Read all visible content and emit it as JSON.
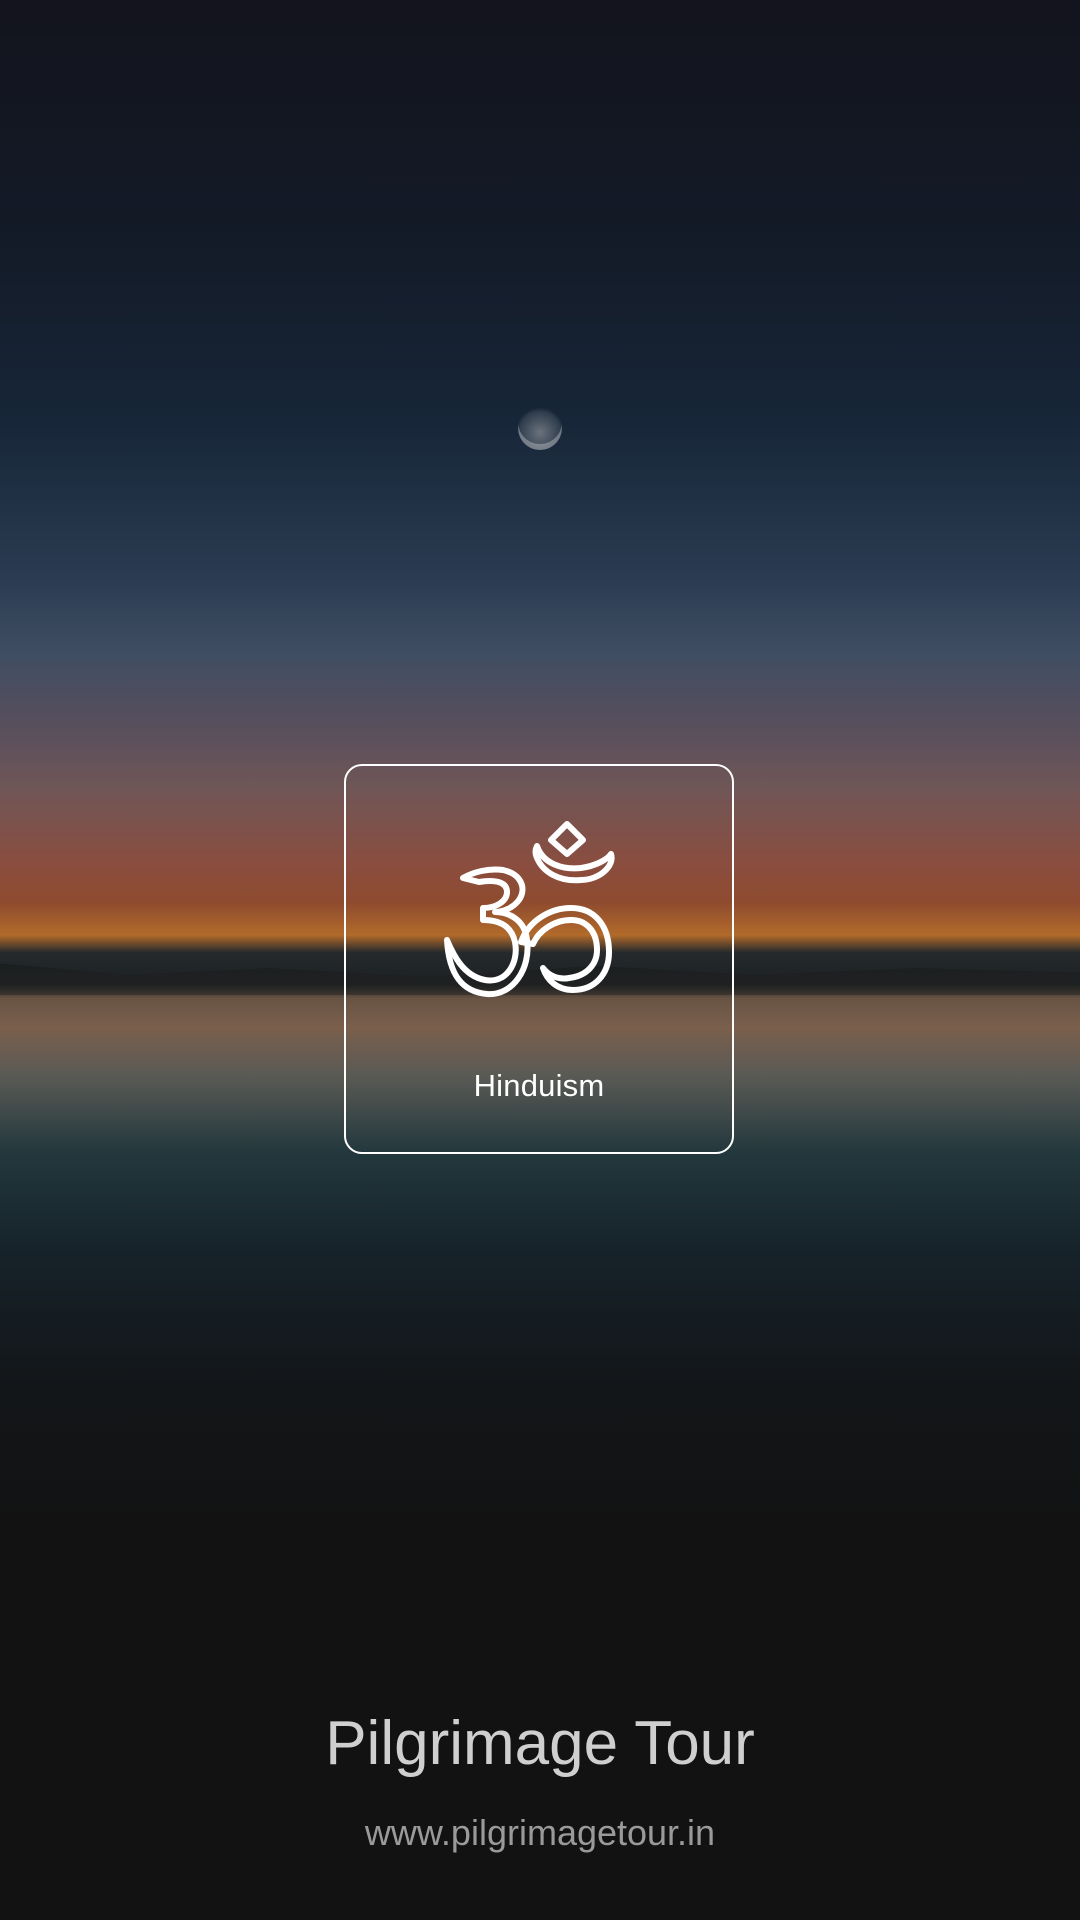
{
  "card": {
    "label": "Hinduism",
    "icon": "om-icon"
  },
  "footer": {
    "title": "Pilgrimage Tour",
    "url": "www.pilgrimagetour.in"
  },
  "colors": {
    "card_border": "#ffffff",
    "title_text": "#cfcfcf",
    "url_text": "#9a9a9a",
    "bottom_background": "#121212"
  }
}
